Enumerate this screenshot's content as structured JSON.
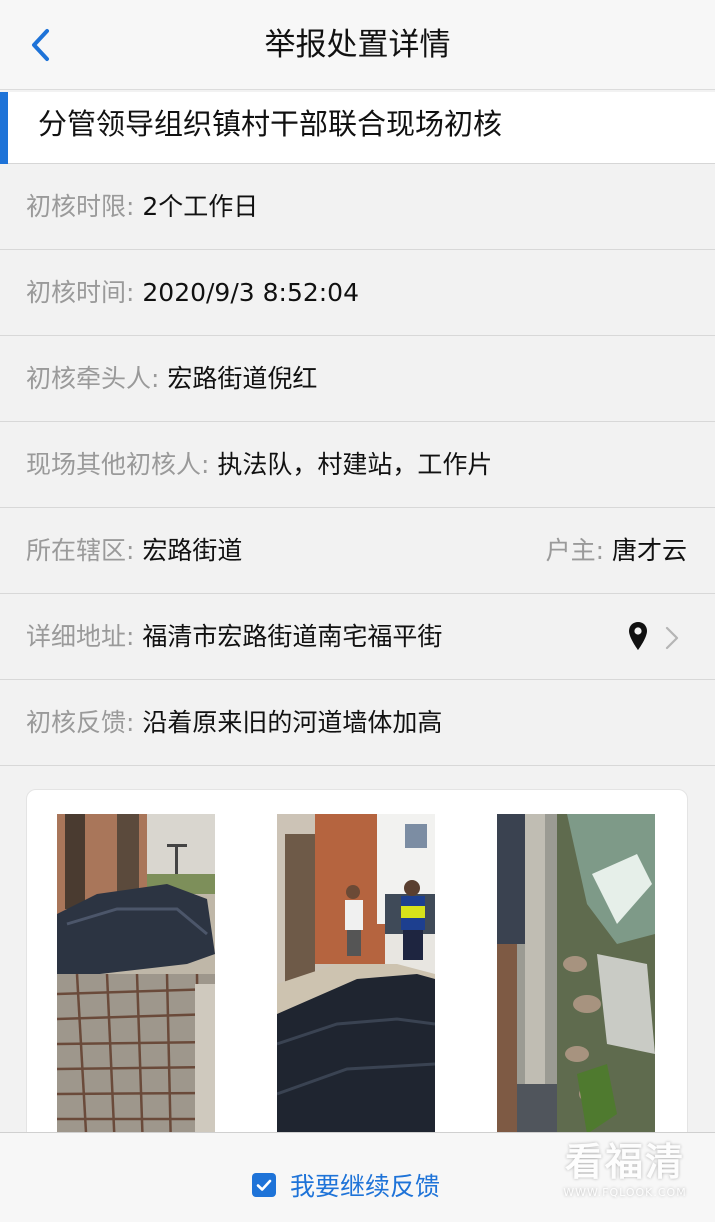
{
  "header": {
    "title": "举报处置详情",
    "back_icon": "chevron-left-icon",
    "accent_color": "#1e73d8"
  },
  "section": {
    "title": "分管领导组织镇村干部联合现场初核"
  },
  "fields": {
    "deadline": {
      "label": "初核时限:",
      "value": "2个工作日"
    },
    "time": {
      "label": "初核时间:",
      "value": "2020/9/3 8:52:04"
    },
    "leader": {
      "label": "初核牵头人:",
      "value": "宏路街道倪红"
    },
    "others": {
      "label": "现场其他初核人:",
      "value": "执法队，村建站，工作片"
    },
    "district": {
      "label": "所在辖区:",
      "value": "宏路街道"
    },
    "owner": {
      "label": "户主:",
      "value": "唐才云"
    },
    "address": {
      "label": "详细地址:",
      "value": "福清市宏路街道南宅福平街",
      "icon": "location-pin-icon"
    },
    "feedback": {
      "label": "初核反馈:",
      "value": "沿着原来旧的河道墙体加高"
    }
  },
  "photos": [
    {
      "name": "photo-1",
      "subject": "rebar mesh under black tarp"
    },
    {
      "name": "photo-2",
      "subject": "workers on tarp near brick wall"
    },
    {
      "name": "photo-3",
      "subject": "river channel wall"
    }
  ],
  "bottom": {
    "continue_label": "我要继续反馈",
    "checked": true
  },
  "watermark": {
    "main": "看福清",
    "sub": "WWW.FQLOOK.COM"
  }
}
